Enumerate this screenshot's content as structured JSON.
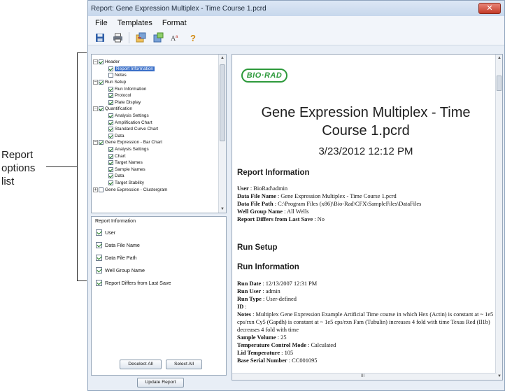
{
  "callout": {
    "label_lines": [
      "Report",
      "options",
      "list"
    ]
  },
  "window": {
    "title": "Report: Gene Expression Multiplex - Time Course 1.pcrd",
    "close_glyph": "✕"
  },
  "menu": [
    "File",
    "Templates",
    "Format"
  ],
  "toolbar_icons": [
    "save-icon",
    "print-icon",
    "load-template-icon",
    "save-template-icon",
    "text-format-icon",
    "help-icon"
  ],
  "tree": {
    "items": [
      {
        "label": "Header",
        "level": 0,
        "expander": "−",
        "checked": true
      },
      {
        "label": "Report Information",
        "level": 1,
        "checked": true,
        "selected": true
      },
      {
        "label": "Notes",
        "level": 1,
        "checked": false
      },
      {
        "label": "Run Setup",
        "level": 0,
        "expander": "−",
        "checked": true
      },
      {
        "label": "Run Information",
        "level": 1,
        "checked": true
      },
      {
        "label": "Protocol",
        "level": 1,
        "checked": true
      },
      {
        "label": "Plate Display",
        "level": 1,
        "checked": true
      },
      {
        "label": "Quantification",
        "level": 0,
        "expander": "−",
        "checked": true
      },
      {
        "label": "Analysis Settings",
        "level": 1,
        "checked": true
      },
      {
        "label": "Amplification Chart",
        "level": 1,
        "checked": true
      },
      {
        "label": "Standard Curve Chart",
        "level": 1,
        "checked": true
      },
      {
        "label": "Data",
        "level": 1,
        "checked": true
      },
      {
        "label": "Gene Expression - Bar Chart",
        "level": 0,
        "expander": "−",
        "checked": true
      },
      {
        "label": "Analysis Settings",
        "level": 1,
        "checked": true
      },
      {
        "label": "Chart",
        "level": 1,
        "checked": true
      },
      {
        "label": "Target Names",
        "level": 1,
        "checked": true
      },
      {
        "label": "Sample Names",
        "level": 1,
        "checked": true
      },
      {
        "label": "Data",
        "level": 1,
        "checked": true
      },
      {
        "label": "Target Stability",
        "level": 1,
        "checked": true
      },
      {
        "label": "Gene Expression - Clustergram",
        "level": 0,
        "expander": "+",
        "checked": false
      }
    ]
  },
  "options": {
    "title": "Report Information",
    "items": [
      {
        "label": "User",
        "checked": true
      },
      {
        "label": "Data File Name",
        "checked": true
      },
      {
        "label": "Data File Path",
        "checked": true
      },
      {
        "label": "Well Group Name",
        "checked": true
      },
      {
        "label": "Report Differs from Last Save",
        "checked": true
      }
    ],
    "deselect_all": "Deselect All",
    "select_all": "Select All"
  },
  "update_button": "Update Report",
  "report": {
    "logo": "BIO·RAD",
    "title": "Gene Expression Multiplex - Time Course 1.pcrd",
    "date": "3/23/2012 12:12 PM",
    "section1": "Report Information",
    "info": [
      {
        "k": "User",
        "v": "BioRad\\admin"
      },
      {
        "k": "Data File Name",
        "v": "Gene Expression Multiplex - Time Course 1.pcrd"
      },
      {
        "k": "Data File Path",
        "v": "C:\\Program Files (x86)\\Bio-Rad\\CFX\\SampleFiles\\DataFiles"
      },
      {
        "k": "Well Group Name",
        "v": "All Wells"
      },
      {
        "k": "Report Differs from Last Save",
        "v": "No"
      }
    ],
    "section2": "Run Setup",
    "section3": "Run Information",
    "run": [
      {
        "k": "Run Date",
        "v": "12/13/2007 12:31 PM"
      },
      {
        "k": "Run User",
        "v": "admin"
      },
      {
        "k": "Run Type",
        "v": "User-defined"
      },
      {
        "k": "ID",
        "v": ""
      },
      {
        "k": "Notes",
        "v": "Multiplex Gene Expression Example Artificial Time course in which Hex (Actin) is constant at ~ 1e5 cps/rxn Cy5 (Gapdh) is constant at ~ 1e5 cps/rxn Fam (Tubulin) increases 4 fold with time Texas Red (Il1b) decreases 4 fold with time"
      },
      {
        "k": "Sample Volume",
        "v": "25"
      },
      {
        "k": "Temperature Control Mode",
        "v": "Calculated"
      },
      {
        "k": "Lid Temperature",
        "v": "105"
      },
      {
        "k": "Base Serial Number",
        "v": "CC001095"
      }
    ],
    "separator": " : ",
    "hscroll_mark": "III"
  }
}
